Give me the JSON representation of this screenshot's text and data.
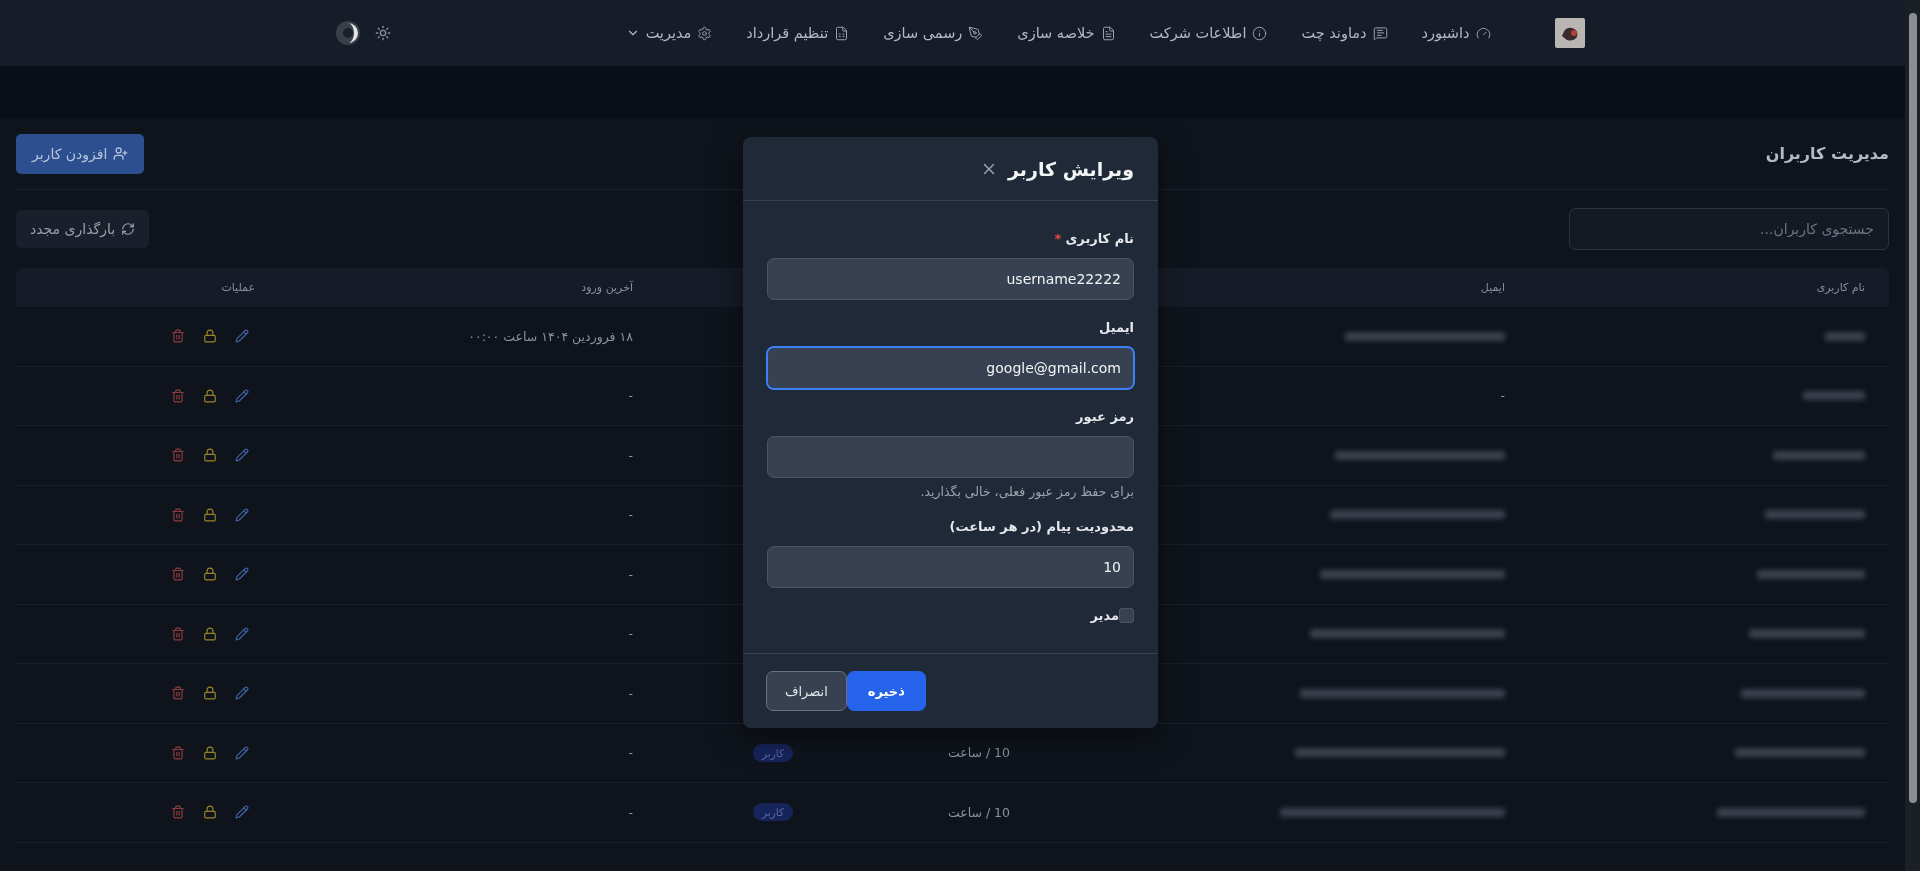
{
  "nav": {
    "items": [
      {
        "label": "داشبورد",
        "has_menu": false
      },
      {
        "label": "دماوند چت",
        "has_menu": false
      },
      {
        "label": "اطلاعات شرکت",
        "has_menu": false
      },
      {
        "label": "خلاصه سازی",
        "has_menu": false
      },
      {
        "label": "رسمی سازی",
        "has_menu": false
      },
      {
        "label": "تنظیم قرارداد",
        "has_menu": false
      },
      {
        "label": "مدیریت",
        "has_menu": true
      }
    ]
  },
  "page": {
    "title": "مدیریت کاربران",
    "add_button": "افزودن کاربر",
    "search": {
      "placeholder": "جستجوی کاربران..."
    },
    "reload_button": "بارگذاری مجدد"
  },
  "table": {
    "columns": [
      {
        "label": "نام کاربری"
      },
      {
        "label": "ایمیل"
      },
      {
        "label": "آخرین ورود"
      },
      {
        "label": "عملیات"
      }
    ],
    "rows": [
      {
        "username_hidden": true,
        "email_hidden": true,
        "last_login": "۱۸ فروردین ۱۴۰۴ ساعت ۰۰:۰۰"
      },
      {
        "username_hidden": true,
        "email_hidden": false,
        "email": "-",
        "last_login": "-"
      },
      {
        "username_hidden": true,
        "email_hidden": true,
        "last_login": "-"
      },
      {
        "username_hidden": true,
        "email_hidden": true,
        "last_login": "-"
      },
      {
        "username_hidden": true,
        "email_hidden": true,
        "last_login": "-"
      },
      {
        "username_hidden": true,
        "email_hidden": true,
        "last_login": "-"
      },
      {
        "username_hidden": true,
        "email_hidden": true,
        "last_login": "-"
      },
      {
        "username_hidden": true,
        "email_hidden": true,
        "limit": "10 / ساعت",
        "role": "کاربر",
        "last_login": "-"
      },
      {
        "username_hidden": true,
        "email_hidden": true,
        "limit": "10 / ساعت",
        "role": "کاربر",
        "last_login": "-"
      }
    ]
  },
  "dialog": {
    "title": "ویرایش کاربر",
    "fields": [
      {
        "kind": "text",
        "label": "نام کاربری",
        "required_mark": "*",
        "value": "username22222",
        "focused": false
      },
      {
        "kind": "text",
        "label": "ایمیل",
        "value": "google@gmail.com",
        "focused": true
      },
      {
        "kind": "password",
        "label": "رمز عبور",
        "focused": false,
        "hint": "برای حفظ رمز عبور فعلی، خالی بگذارید."
      },
      {
        "kind": "text",
        "label": "محدودیت پیام (در هر ساعت)",
        "value": "10",
        "focused": false
      },
      {
        "kind": "checkbox",
        "label": "مدیر",
        "checked": false
      }
    ],
    "buttons": [
      {
        "label": "ذخیره",
        "primary": true
      },
      {
        "label": "انصراف",
        "primary": false
      }
    ]
  }
}
